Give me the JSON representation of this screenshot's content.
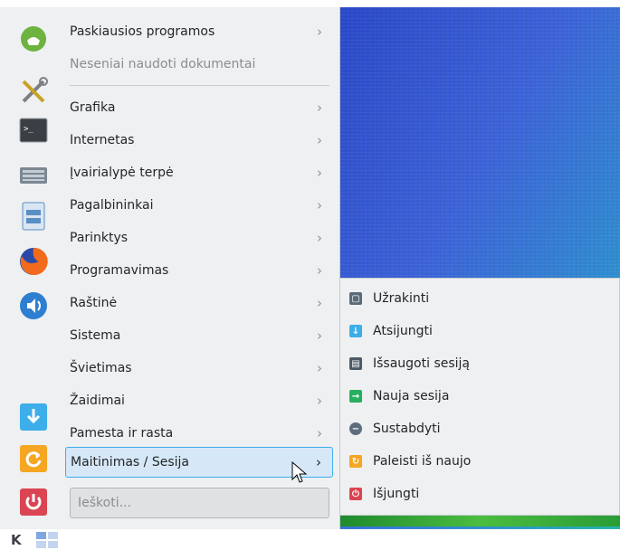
{
  "menu": {
    "items": [
      {
        "label": "Paskiausios programos",
        "chevron": "›"
      },
      {
        "label": "Neseniai naudoti dokumentai",
        "chevron": ""
      },
      {
        "label": "Grafika",
        "chevron": "›"
      },
      {
        "label": "Internetas",
        "chevron": "›"
      },
      {
        "label": "Įvairialypė terpė",
        "chevron": "›"
      },
      {
        "label": "Pagalbininkai",
        "chevron": "›"
      },
      {
        "label": "Parinktys",
        "chevron": "›"
      },
      {
        "label": "Programavimas",
        "chevron": "›"
      },
      {
        "label": "Raštinė",
        "chevron": "›"
      },
      {
        "label": "Sistema",
        "chevron": "›"
      },
      {
        "label": "Švietimas",
        "chevron": "›"
      },
      {
        "label": "Žaidimai",
        "chevron": "›"
      },
      {
        "label": "Pamesta ir rasta",
        "chevron": "›"
      },
      {
        "label": "Maitinimas / Sesija",
        "chevron": "›"
      }
    ],
    "search_placeholder": "Ieškoti..."
  },
  "submenu": {
    "items": [
      {
        "label": "Užrakinti",
        "icon": "lock-icon",
        "color": "#5b6b7a"
      },
      {
        "label": "Atsijungti",
        "icon": "logout-arrow-icon",
        "color": "#3daee9"
      },
      {
        "label": "Išsaugoti sesiją",
        "icon": "save-session-icon",
        "color": "#4d5a66"
      },
      {
        "label": "Nauja sesija",
        "icon": "new-session-icon",
        "color": "#27ae60"
      },
      {
        "label": "Sustabdyti",
        "icon": "suspend-icon",
        "color": "#5d6d7e"
      },
      {
        "label": "Paleisti iš naujo",
        "icon": "restart-icon",
        "color": "#f5a623"
      },
      {
        "label": "Išjungti",
        "icon": "power-icon",
        "color": "#da4453"
      }
    ]
  },
  "sidebar": {
    "favorites": [
      "mint-app-icon",
      "tools-icon",
      "terminal-icon",
      "keyboard-icon",
      "file-manager-icon",
      "firefox-icon",
      "volume-icon"
    ],
    "actions": [
      "logout-icon",
      "restart-icon",
      "shutdown-icon"
    ]
  },
  "taskbar": {
    "logo": "K"
  }
}
